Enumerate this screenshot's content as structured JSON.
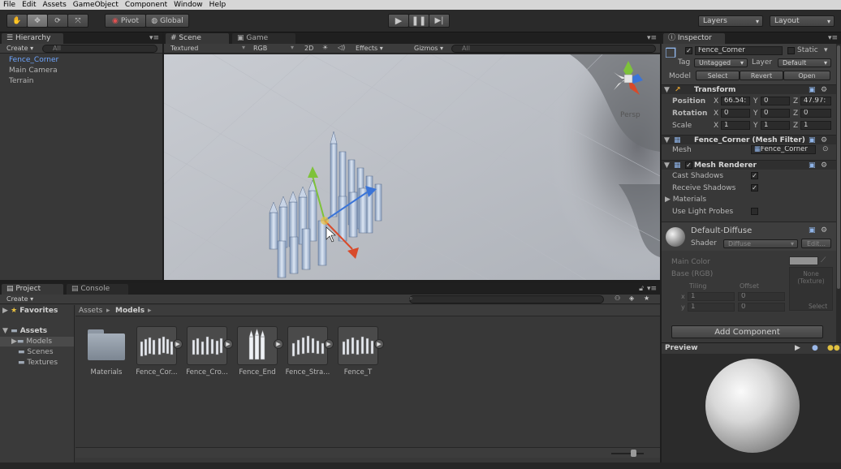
{
  "menu": [
    "File",
    "Edit",
    "Assets",
    "GameObject",
    "Component",
    "Window",
    "Help"
  ],
  "toolbar": {
    "pivot_label": "Pivot",
    "global_label": "Global",
    "layers_label": "Layers",
    "layout_label": "Layout"
  },
  "hierarchy": {
    "tab": "Hierarchy",
    "create_label": "Create",
    "search_placeholder": "All",
    "items": [
      "Fence_Corner",
      "Main Camera",
      "Terrain"
    ]
  },
  "scene": {
    "tabs": [
      "Scene",
      "Game"
    ],
    "render_mode": "Textured",
    "color_mode": "RGB",
    "mode_2d": "2D",
    "effects_label": "Effects",
    "gizmos_label": "Gizmos",
    "search_placeholder": "All",
    "persp_label": "Persp"
  },
  "inspector": {
    "tab": "Inspector",
    "object_name": "Fence_Corner",
    "static_label": "Static",
    "tag_label": "Tag",
    "tag_value": "Untagged",
    "layer_label": "Layer",
    "layer_value": "Default",
    "model_label": "Model",
    "select_label": "Select",
    "revert_label": "Revert",
    "open_label": "Open",
    "transform": {
      "title": "Transform",
      "position_label": "Position",
      "rotation_label": "Rotation",
      "scale_label": "Scale",
      "x_label": "X",
      "y_label": "Y",
      "z_label": "Z",
      "position": [
        "66.54:",
        "0",
        "47.97:"
      ],
      "rotation": [
        "0",
        "0",
        "0"
      ],
      "scale": [
        "1",
        "1",
        "1"
      ]
    },
    "mesh_filter": {
      "title": "Fence_Corner (Mesh Filter)",
      "mesh_label": "Mesh",
      "mesh_value": "Fence_Corner"
    },
    "mesh_renderer": {
      "title": "Mesh Renderer",
      "cast_shadows": "Cast Shadows",
      "receive_shadows": "Receive Shadows",
      "materials": "Materials",
      "light_probes": "Use Light Probes"
    },
    "material": {
      "name": "Default-Diffuse",
      "shader_label": "Shader",
      "shader_value": "Diffuse",
      "edit_label": "Edit...",
      "main_color": "Main Color",
      "base_label": "Base (RGB)",
      "tiling_label": "Tiling",
      "offset_label": "Offset",
      "x_label": "x",
      "y_label": "y",
      "tiling_x": "1",
      "tiling_y": "1",
      "offset_x": "0",
      "offset_y": "0",
      "none_texture": "None\n(Texture)",
      "select_label": "Select"
    },
    "add_component": "Add Component",
    "preview_label": "Preview"
  },
  "project": {
    "tabs": [
      "Project",
      "Console"
    ],
    "create_label": "Create",
    "favorites": "Favorites",
    "assets": "Assets",
    "folders": [
      "Models",
      "Scenes",
      "Textures"
    ],
    "breadcrumb": [
      "Assets",
      "Models"
    ],
    "items": [
      "Materials",
      "Fence_Cor...",
      "Fence_Cro...",
      "Fence_End",
      "Fence_Stra...",
      "Fence_T"
    ]
  },
  "colors": {
    "accent": "#3d6fb5",
    "selected": "#3d6fb5",
    "panel": "#383838",
    "x_axis": "#d84a2a",
    "y_axis": "#7ec23a",
    "z_axis": "#3a74d8"
  }
}
